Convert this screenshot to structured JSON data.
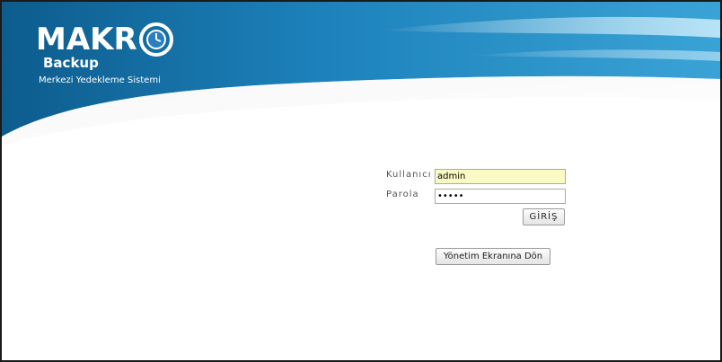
{
  "brand": {
    "name": "MAKR",
    "product": "Backup",
    "tagline": "Merkezi Yedekleme Sistemi",
    "colors": {
      "banner_dark": "#0e5f8f",
      "banner_light": "#2b94c9",
      "accent": "#7cc4ea"
    },
    "icon": "clock-icon"
  },
  "login": {
    "username_label": "Kullanıcı",
    "username_value": "admin",
    "password_label": "Parola",
    "password_value": "•••••",
    "submit_label": "GİRİŞ"
  },
  "actions": {
    "back_label": "Yönetim Ekranına Dön"
  }
}
